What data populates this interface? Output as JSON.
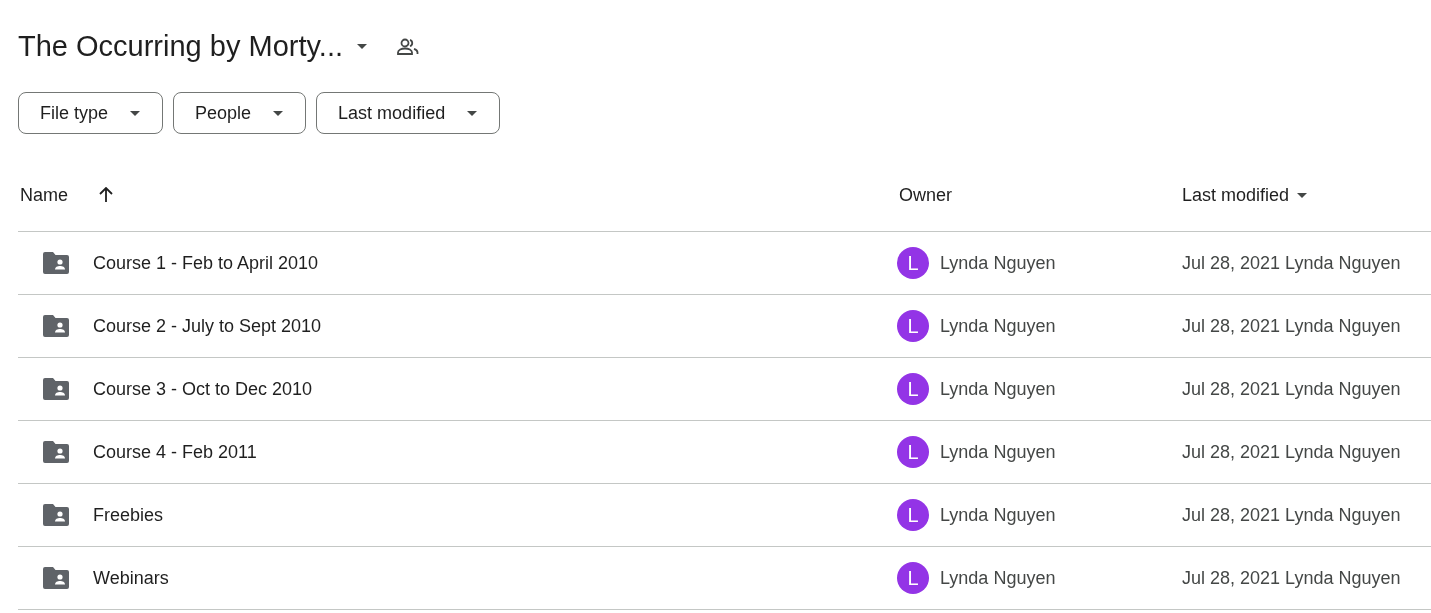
{
  "title": "The Occurring by Morty...",
  "filters": [
    {
      "label": "File type"
    },
    {
      "label": "People"
    },
    {
      "label": "Last modified"
    }
  ],
  "table": {
    "columns": [
      {
        "label": "Name",
        "kind": "sort-up"
      },
      {
        "label": "Owner",
        "kind": "plain"
      },
      {
        "label": "Last modified",
        "kind": "sort-down"
      }
    ],
    "rows": [
      {
        "name": "Course 1 - Feb to April 2010",
        "owner": "Lynda Nguyen",
        "avatar_letter": "L",
        "color": "#9334e6",
        "modified": "Jul 28, 2021 Lynda Nguyen"
      },
      {
        "name": "Course 2 - July to Sept 2010",
        "owner": "Lynda Nguyen",
        "avatar_letter": "L",
        "color": "#9334e6",
        "modified": "Jul 28, 2021 Lynda Nguyen"
      },
      {
        "name": "Course 3 - Oct to Dec 2010",
        "owner": "Lynda Nguyen",
        "avatar_letter": "L",
        "color": "#9334e6",
        "modified": "Jul 28, 2021 Lynda Nguyen"
      },
      {
        "name": "Course 4 - Feb 2011",
        "owner": "Lynda Nguyen",
        "avatar_letter": "L",
        "color": "#9334e6",
        "modified": "Jul 28, 2021 Lynda Nguyen"
      },
      {
        "name": "Freebies",
        "owner": "Lynda Nguyen",
        "avatar_letter": "L",
        "color": "#9334e6",
        "modified": "Jul 28, 2021 Lynda Nguyen"
      },
      {
        "name": "Webinars",
        "owner": "Lynda Nguyen",
        "avatar_letter": "L",
        "color": "#9334e6",
        "modified": "Jul 28, 2021 Lynda Nguyen"
      }
    ]
  }
}
